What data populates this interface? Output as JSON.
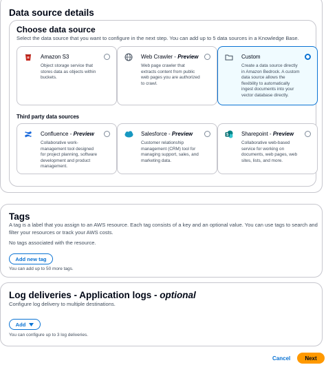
{
  "data_source_details": {
    "title": "Data source details",
    "choose": {
      "title": "Choose data source",
      "description": "Select the data source that you want to configure in the next step. You can add up to 5 data sources in a Knowledge Base.",
      "cards": [
        {
          "label": "Amazon S3",
          "preview": "",
          "description": "Object storage service that stores data as objects within buckets.",
          "icon": "s3-icon",
          "selected": false
        },
        {
          "label": "Web Crawler - ",
          "preview": "Preview",
          "description": "Web page crawler that extracts content from public web pages you are authorized to crawl.",
          "icon": "globe-icon",
          "selected": false
        },
        {
          "label": "Custom",
          "preview": "",
          "description": "Create a data source directly in Amazon Bedrock. A custom data source allows the flexibility to automatically ingest documents into your vector database directly.",
          "icon": "folder-icon",
          "selected": true
        }
      ],
      "third_party_title": "Third party data sources",
      "third_party_cards": [
        {
          "label": "Confluence - ",
          "preview": "Preview",
          "description": "Collaborative work-management tool designed for project planning, software development and product management.",
          "icon": "confluence-icon",
          "selected": false
        },
        {
          "label": "Salesforce - ",
          "preview": "Preview",
          "description": "Customer relationship management (CRM) tool for managing support, sales, and marketing data.",
          "icon": "salesforce-icon",
          "selected": false
        },
        {
          "label": "Sharepoint - ",
          "preview": "Preview",
          "description": "Collaborative web-based service for working on documents, web pages, web sites, lists, and more.",
          "icon": "sharepoint-icon",
          "selected": false
        }
      ]
    }
  },
  "tags": {
    "title": "Tags",
    "description": "A tag is a label that you assign to an AWS resource. Each tag consists of a key and an optional value. You can use tags to search and filter your resources or track your AWS costs.",
    "empty": "No tags associated with the resource.",
    "add_button": "Add new tag",
    "hint": "You can add up to 50 more tags."
  },
  "log_deliveries": {
    "title": "Log deliveries - Application logs - ",
    "optional": "optional",
    "description": "Configure log delivery to multiple destinations.",
    "add_button": "Add",
    "hint": "You can configure up to 3 log deliveries."
  },
  "footer": {
    "cancel": "Cancel",
    "next": "Next"
  },
  "colors": {
    "accent": "#0972d3",
    "primary_button": "#ff9900",
    "selected_bg": "#f0fbff",
    "border": "#c6c6cd"
  }
}
